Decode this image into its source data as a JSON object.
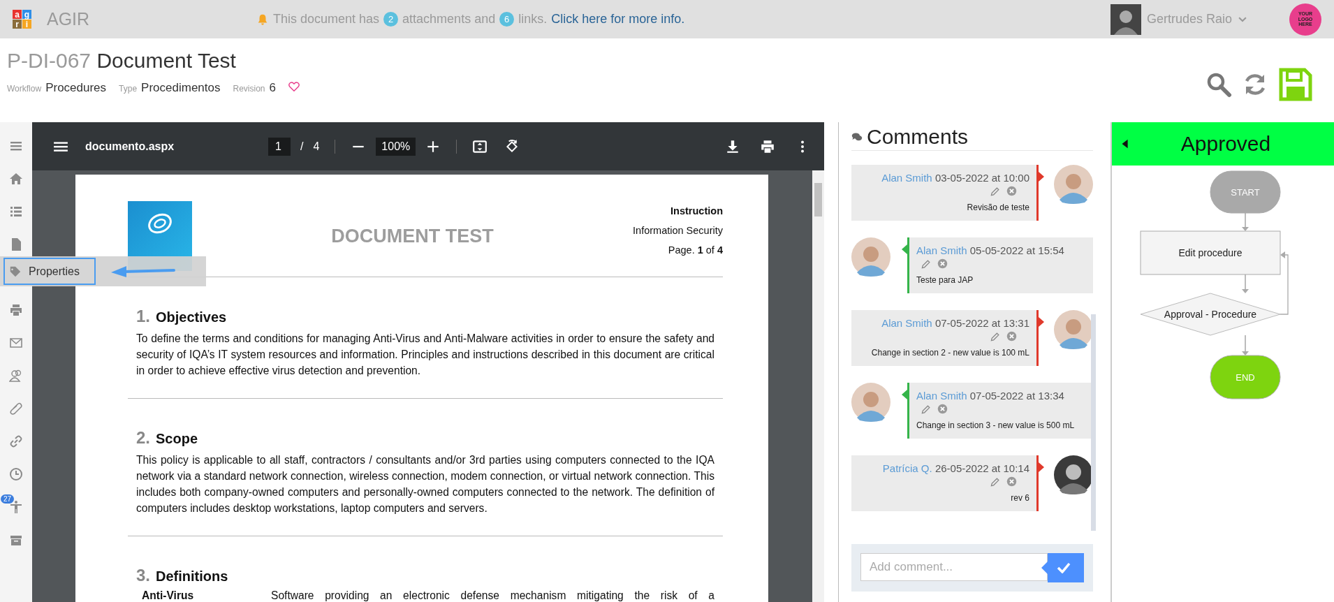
{
  "topbar": {
    "logo_letters": [
      {
        "letter": "a",
        "color": "#e8322f"
      },
      {
        "letter": "g",
        "color": "#2f8fe8"
      },
      {
        "letter": "r",
        "color": "#8a6d3b"
      },
      {
        "letter": "i",
        "color": "#f5a623"
      }
    ],
    "app_name": "AGIR",
    "notice": {
      "before": "This document has",
      "attachments": "2",
      "middle": "attachments and",
      "links": "6",
      "after": "links.",
      "link": "Click here for more info."
    },
    "user": {
      "name": "Gertrudes Raio"
    },
    "brand_logo": "YOUR LOGO HERE"
  },
  "document": {
    "code": "P-DI-067",
    "title": "Document Test",
    "meta": [
      {
        "label": "Workflow",
        "value": "Procedures"
      },
      {
        "label": "Type",
        "value": "Procedimentos"
      },
      {
        "label": "Revision",
        "value": "6"
      }
    ],
    "favorite": false
  },
  "sidebar": {
    "badge": "27",
    "tooltip": "Properties"
  },
  "viewer": {
    "file": "documento.aspx",
    "page": "1",
    "separator": "/",
    "pages": "4",
    "zoom": "100%",
    "page_content": {
      "title": "DOCUMENT TEST",
      "kind_label": "Instruction",
      "area": "Information Security",
      "page_line": "Page. **1** of **4**",
      "sections": [
        {
          "number": "1.",
          "heading": "Objectives",
          "body": "To define the terms and conditions for managing Anti-Virus and Anti-Malware activities in order to ensure the safety and security of IQA’s IT system resources and information. Principles and instructions described in this document are critical in order to achieve effective virus detection and prevention."
        },
        {
          "number": "2.",
          "heading": "Scope",
          "body": "This policy is applicable to all staff, contractors / consultants and/or 3rd parties using computers connected to the IQA network via a standard network connection, wireless connection, modem connection, or virtual network connection. This includes both company-owned computers and personally-owned computers connected to the network. The definition of computers includes desktop workstations, laptop computers and servers."
        },
        {
          "number": "3.",
          "heading": "Definitions",
          "definitions": [
            {
              "term": "Anti-Virus",
              "definition": "Software providing an electronic defense mechanism mitigating the risk of a"
            }
          ]
        }
      ]
    }
  },
  "comments": {
    "title": "Comments",
    "items": [
      {
        "author": "Alan Smith",
        "date": "03-05-2022 at 10:00",
        "text": "Revisão de teste",
        "kind": "right"
      },
      {
        "author": "Alan Smith",
        "date": "05-05-2022 at 15:54",
        "text": "Teste para JAP",
        "kind": "left"
      },
      {
        "author": "Alan Smith",
        "date": "07-05-2022 at 13:31",
        "text": "Change in section 2 - new value is 100 mL",
        "kind": "right"
      },
      {
        "author": "Alan Smith",
        "date": "07-05-2022 at 13:34",
        "text": "Change in section 3 - new value is 500 mL",
        "kind": "left"
      },
      {
        "author": "Patrícia Q.",
        "date": "26-05-2022 at 10:14",
        "text": "rev 6",
        "kind": "right"
      }
    ],
    "placeholder": "Add comment..."
  },
  "workflow": {
    "status": "Approved",
    "nodes": [
      {
        "kind": "start",
        "label": "START",
        "current": false
      },
      {
        "kind": "task",
        "label": "Edit procedure",
        "current": false
      },
      {
        "kind": "decision",
        "label": "Approval - Procedure",
        "current": false
      },
      {
        "kind": "end",
        "label": "END",
        "current": true
      }
    ]
  }
}
